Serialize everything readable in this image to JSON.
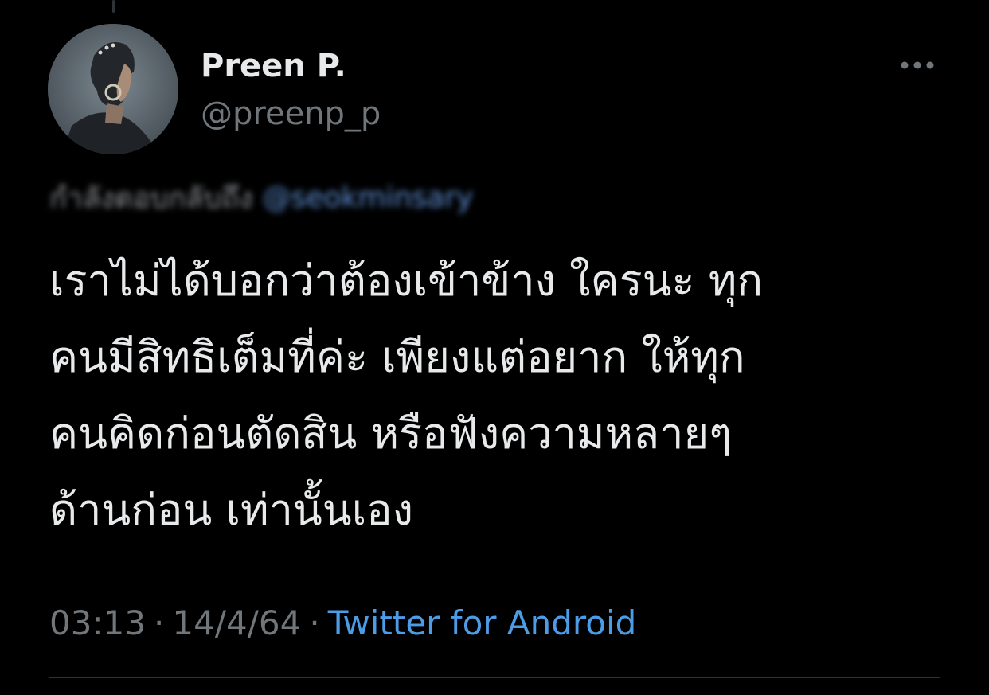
{
  "author": {
    "display_name": "Preen P.",
    "handle": "@preenp_p"
  },
  "reply_context": {
    "label": "กำลังตอบกลับถึง",
    "handle": "@seokminsary",
    "blurred": true
  },
  "tweet": {
    "lines": [
      "เราไม่ได้บอกว่าต้องเข้าข้าง ใครนะ ทุก",
      "คนมีสิทธิเต็มที่ค่ะ เพียงแต่อยาก ให้ทุก",
      "คนคิดก่อนตัดสิน หรือฟังความหลายๆ",
      "ด้านก่อน เท่านั้นเอง"
    ]
  },
  "meta": {
    "time": "03:13",
    "date": "14/4/64",
    "separator": "·",
    "source": "Twitter for Android"
  },
  "icons": {
    "more": "more-horizontal-icon"
  },
  "colors": {
    "background": "#000000",
    "primary_text": "#e7e9ea",
    "secondary_text": "#71767b",
    "link": "#4c9ce8",
    "divider": "#2f3336"
  }
}
